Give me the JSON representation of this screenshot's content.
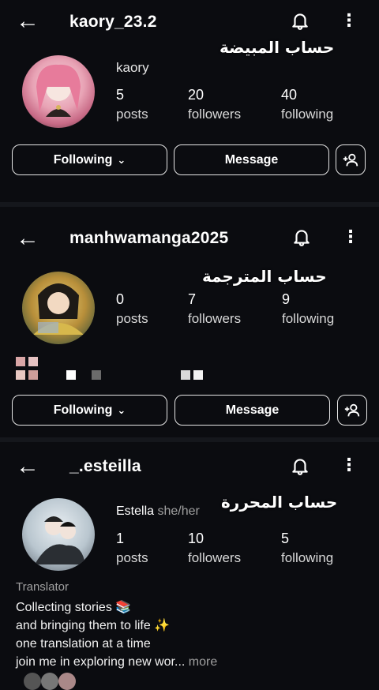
{
  "profiles": [
    {
      "username": "kaory_23.2",
      "caption_ar": "حساب المبيضة",
      "display_name": "kaory",
      "stats": [
        {
          "value": "5",
          "label": "posts"
        },
        {
          "value": "20",
          "label": "followers"
        },
        {
          "value": "40",
          "label": "following"
        }
      ],
      "following_label": "Following",
      "message_label": "Message"
    },
    {
      "username": "manhwamanga2025",
      "caption_ar": "حساب المترجمة",
      "stats": [
        {
          "value": "0",
          "label": "posts"
        },
        {
          "value": "7",
          "label": "followers"
        },
        {
          "value": "9",
          "label": "following"
        }
      ],
      "following_label": "Following",
      "message_label": "Message"
    },
    {
      "username": "_.esteilla",
      "caption_ar": "حساب المحررة",
      "display_name": "Estella",
      "pronouns": "she/her",
      "stats": [
        {
          "value": "1",
          "label": "posts"
        },
        {
          "value": "10",
          "label": "followers"
        },
        {
          "value": "5",
          "label": "following"
        }
      ],
      "category": "Translator",
      "bio": [
        "Collecting stories 📚",
        "and bringing them to life ✨",
        "one translation at a time",
        "join me in exploring new wor..."
      ],
      "more_label": "more"
    }
  ],
  "icons": {
    "back": "←",
    "menu": "⋮",
    "chevron": "⌄"
  },
  "colors": {
    "background": "#0b0c10",
    "text": "#f2f2f2",
    "border": "#e6e6e6"
  }
}
